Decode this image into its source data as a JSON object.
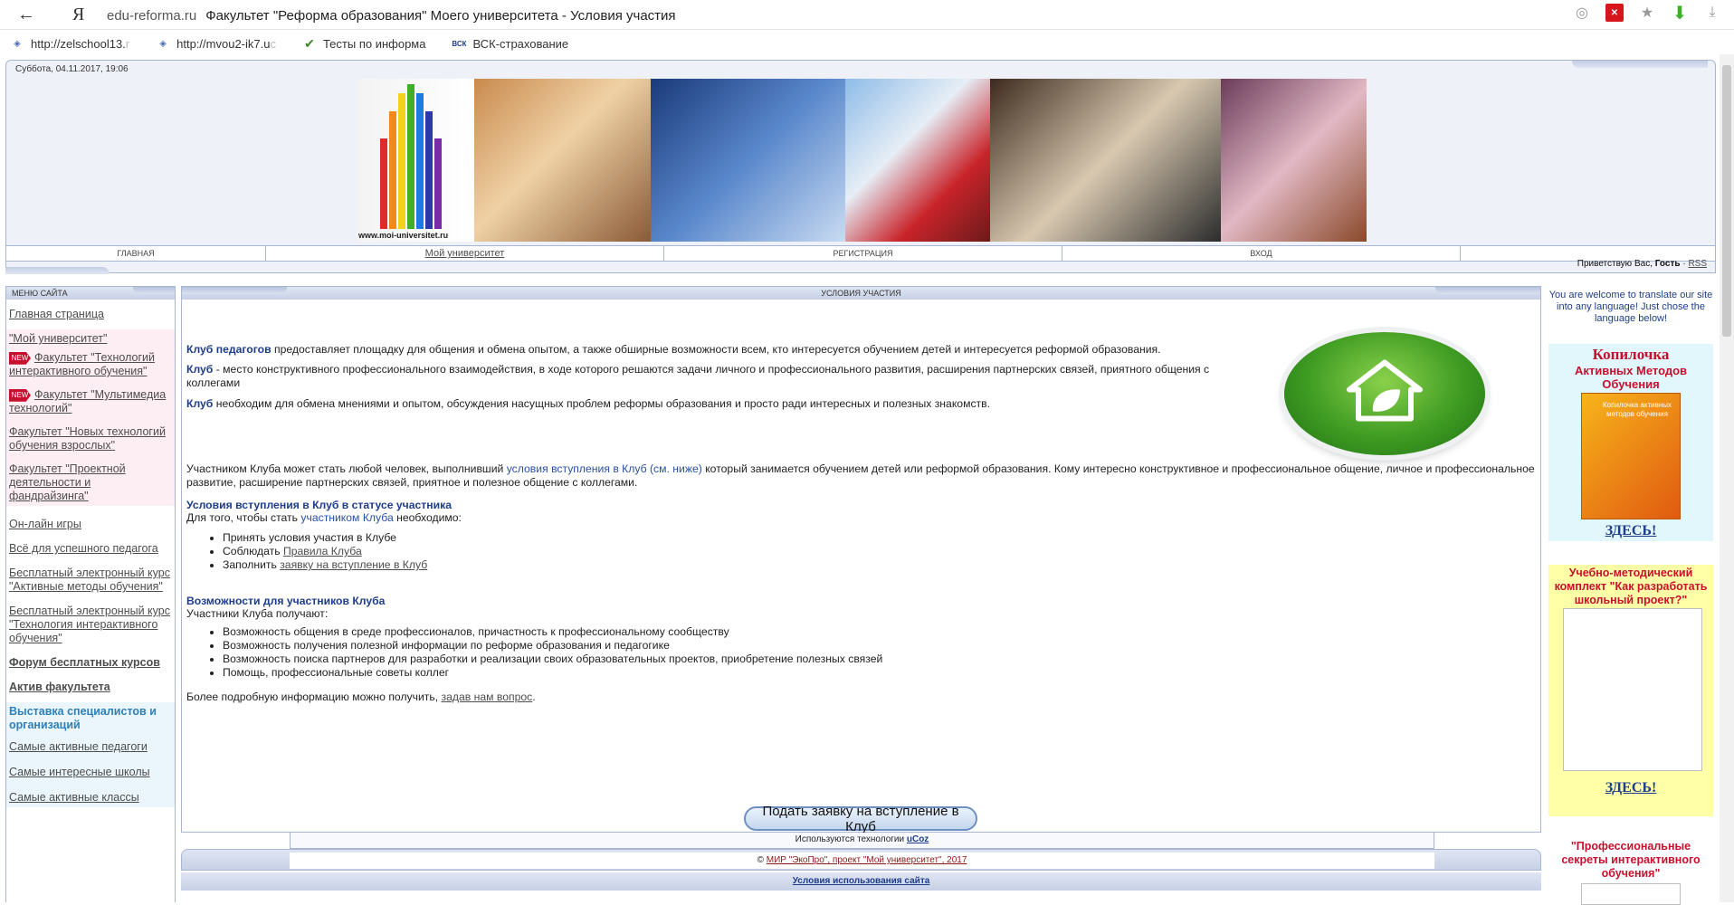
{
  "browser": {
    "domain": "edu-reforma.ru",
    "title": "Факультет \"Реформа образования\" Моего университета - Условия участия",
    "ya": "Я",
    "back_icon": "arrow-left-icon",
    "bookmarks": [
      {
        "label": "http://zelschool13.",
        "faded": "r"
      },
      {
        "label": "http://mvou2-ik7.u",
        "faded": "c"
      },
      {
        "label": "Тесты по информа",
        "faded": ""
      },
      {
        "label": "ВСК-страхование",
        "faded": ""
      }
    ],
    "bookmark_badge": "ВСК"
  },
  "header": {
    "date": "Суббота, 04.11.2017, 19:06",
    "banner_url": "www.moi-universitet.ru",
    "menu": [
      {
        "label": "ГЛАВНАЯ",
        "link": false
      },
      {
        "label": "Мой университет",
        "link": true
      },
      {
        "label": "РЕГИСТРАЦИЯ",
        "link": false
      },
      {
        "label": "ВХОД",
        "link": false
      }
    ],
    "greeting_prefix": "Приветствую Вас,",
    "greeting_user": "Гость",
    "greeting_sep": "·",
    "rss": "RSS"
  },
  "left_menu": {
    "title": "МЕНЮ САЙТА",
    "items": [
      {
        "label": "Главная страница",
        "style": ""
      },
      {
        "label": "\"Мой университет\"",
        "style": "pink"
      },
      {
        "label": "Факультет \"Технологий интерактивного обучения\"",
        "style": "pink",
        "new": true
      },
      {
        "label": "Факультет \"Мультимедиа технологий\"",
        "style": "pink",
        "new": true
      },
      {
        "label": "Факультет \"Новых технологий обучения взрослых\"",
        "style": "pink"
      },
      {
        "label": "Факультет \"Проектной деятельности и фандрайзинга\"",
        "style": "pink"
      },
      {
        "label": "Он-лайн игры",
        "style": ""
      },
      {
        "label": "Всё для успешного педагога",
        "style": ""
      },
      {
        "label": "Бесплатный электронный курс \"Активные методы обучения\"",
        "style": ""
      },
      {
        "label": "Бесплатный электронный курс \"Технология интерактивного обучения\"",
        "style": ""
      },
      {
        "label": "Форум бесплатных курсов",
        "style": "bold"
      },
      {
        "label": "Актив факультета",
        "style": "bold"
      },
      {
        "label": "Выставка специалистов и организаций",
        "style": "strong-blue"
      },
      {
        "label": "Самые активные педагоги",
        "style": "blue"
      },
      {
        "label": "Самые интересные школы",
        "style": "blue"
      },
      {
        "label": "Самые активные классы",
        "style": "blue"
      }
    ],
    "new_badge": "NEW"
  },
  "main": {
    "title": "УСЛОВИЯ УЧАСТИЯ",
    "p1_bold": "Клуб педагогов",
    "p1_rest": " предоставляет площадку для общения и обмена опытом, а также обширные возможности всем, кто интересуется обучением детей и интересуется реформой образования.",
    "p2_bold": "Клуб",
    "p2_rest": " - место конструктивного профессионального взаимодействия, в ходе которого решаются задачи личного и профессионального развития, расширения партнерских связей, приятного общения с коллегами",
    "p3_bold": "Клуб",
    "p3_rest": " необходим для обмена мнениями и опытом, обсуждения насущных проблем реформы образования и просто ради интересных и полезных знакомств.",
    "p4_a": "Участником Клуба может стать любой человек, выполнивший ",
    "p4_link": "условия вступления в Клуб (см. ниже)",
    "p4_b": " который занимается обучением детей или реформой образования. Кому интересно конструктивное и профессиональное общение, личное и профессиональное развитие, расширение партнерских связей, приятное и полезное общение с коллегами.",
    "h1": "Условия вступления в Клуб в статусе участника",
    "h1_sub_a": "Для того, чтобы стать ",
    "h1_sub_link": "участником Клуба",
    "h1_sub_b": " необходимо:",
    "cond1": "Принять условия участия в Клубе",
    "cond2_a": "Соблюдать ",
    "cond2_link": "Правила Клуба",
    "cond3_a": "Заполнить ",
    "cond3_link": "заявку на вступление в Клуб",
    "h2": "Возможности для участников Клуба",
    "h2_sub": "Участники Клуба получают:",
    "opps": [
      "Возможность общения в среде профессионалов, причастность к профессиональному сообществу",
      "Возможность получения полезной информации по реформе образования и педагогике",
      "Возможность поиска партнеров для разработки и реализации своих образовательных проектов, приобретение полезных связей",
      "Помощь, профессиональные советы коллег"
    ],
    "more_a": "Более подробную информацию можно получить, ",
    "more_link": "задав нам вопрос",
    "more_b": ".",
    "apply_btn": "Подать заявку на вступление в Клуб",
    "house_icon": "house-leaf-icon"
  },
  "footer": {
    "tech_a": "Используются технологии ",
    "tech_link": "uCoz",
    "copy_a": "© ",
    "copy_link": "МИР \"ЭкоПро\", проект \"Мой университет\", 2017",
    "terms": "Условия использования сайта"
  },
  "right": {
    "translate": "You are welcome to translate our site into any language! Just chose the language below!",
    "kop_title": "Копилочка",
    "kop_sub": "Активных Методов Обучения",
    "kop_book": "Копилочка активных методов обучения",
    "here": "ЗДЕСЬ!",
    "umk_title": "Учебно-методический комплект \"Как разработать школьный проект?\"",
    "prof_title": "\"Профессиональные секреты интерактивного обучения\""
  }
}
